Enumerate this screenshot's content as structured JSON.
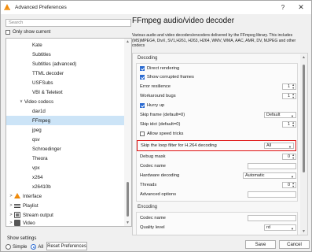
{
  "window": {
    "title": "Advanced Preferences",
    "help": "?",
    "close": "✕"
  },
  "search": {
    "placeholder": "Search"
  },
  "only_show_current": "Only show current",
  "tree": [
    {
      "label": "Kate",
      "selected": false
    },
    {
      "label": "Subtitles",
      "selected": false
    },
    {
      "label": "Subtitles (advanced)",
      "selected": false
    },
    {
      "label": "TTML decoder",
      "selected": false
    },
    {
      "label": "USFSubs",
      "selected": false
    },
    {
      "label": "VBI & Teletext",
      "selected": false
    },
    {
      "label": "Video codecs",
      "expanded": true,
      "selected": false
    },
    {
      "label": "dav1d",
      "selected": false
    },
    {
      "label": "FFmpeg",
      "selected": true
    },
    {
      "label": "jpeg",
      "selected": false
    },
    {
      "label": "qsv",
      "selected": false
    },
    {
      "label": "Schroedinger",
      "selected": false
    },
    {
      "label": "Theora",
      "selected": false
    },
    {
      "label": "vpx",
      "selected": false
    },
    {
      "label": "x264",
      "selected": false
    },
    {
      "label": "x26410b",
      "selected": false
    },
    {
      "label": "Interface",
      "icon": "interface-icon"
    },
    {
      "label": "Playlist",
      "icon": "playlist-icon"
    },
    {
      "label": "Stream output",
      "icon": "stream-output-icon"
    },
    {
      "label": "Video",
      "icon": "video-icon"
    }
  ],
  "show_settings": {
    "label": "Show settings",
    "simple": "Simple",
    "all": "All",
    "selected": "All",
    "reset": "Reset Preferences"
  },
  "panel": {
    "title": "FFmpeg audio/video decoder",
    "description": "Various audio and video decoders/encoders delivered by the FFmpeg library. This includes (MS)MPEG4, DivX, SV1,H261, H263, H264, WMV, WMA, AAC, AMR, DV, MJPEG and other codecs",
    "decoding": {
      "title": "Decoding",
      "direct_rendering": "Direct rendering",
      "show_corrupted": "Show corrupted frames",
      "error_resilience": "Error resilience",
      "error_resilience_value": "1",
      "workaround_bugs": "Workaround bugs",
      "workaround_bugs_value": "1",
      "hurry_up": "Hurry up",
      "skip_frame": "Skip frame (default=0)",
      "skip_frame_value": "Default",
      "skip_idct": "Skip idct (default=0)",
      "skip_idct_value": "1",
      "allow_speed_tricks": "Allow speed tricks",
      "skip_loop_filter": "Skip the loop filter for H.264 decoding",
      "skip_loop_filter_value": "All",
      "debug_mask": "Debug mask",
      "debug_mask_value": "0",
      "codec_name": "Codec name",
      "hardware_decoding": "Hardware decoding",
      "hardware_decoding_value": "Automatic",
      "threads": "Threads",
      "threads_value": "0",
      "advanced_options": "Advanced options"
    },
    "encoding": {
      "title": "Encoding",
      "codec_name": "Codec name",
      "quality_level": "Quality level",
      "quality_level_value": "rd"
    }
  },
  "buttons": {
    "save": "Save",
    "cancel": "Cancel"
  },
  "colors": {
    "highlight": "#e01010",
    "selection": "#cce4f7",
    "accent": "#2b6bd1"
  }
}
